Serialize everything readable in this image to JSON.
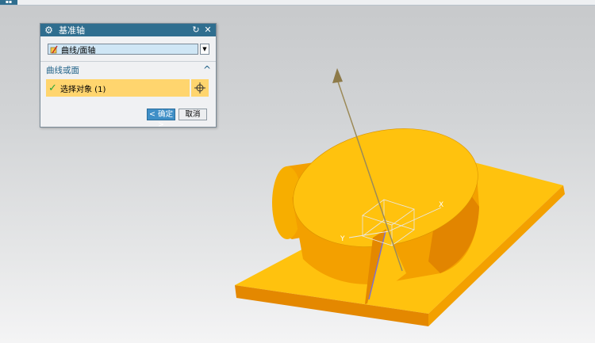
{
  "dialog": {
    "title": "基准轴",
    "type_select": {
      "selected": "曲线/面轴"
    },
    "ok_label": "< 确定 >",
    "cancel_label": "取消"
  },
  "group": {
    "title": "曲线或面",
    "select_object_label": "选择对象 (1)"
  },
  "viewport": {
    "csys_labels": {
      "y": "Y",
      "x": "X"
    }
  },
  "colors": {
    "titlebar": "#2f6e8f",
    "model_top": "#ffc20e",
    "model_side": "#f3a000",
    "model_shadow": "#e48800",
    "selection_highlight": "#ffd56e",
    "vector": "#9c8a58",
    "ok_button": "#3f8fc7"
  },
  "icons": [
    "settings-gear-icon",
    "reset-icon",
    "close-icon",
    "curve-face-axis-icon",
    "dropdown-arrow-icon",
    "collapse-chevron-icon",
    "check-icon",
    "point-dialog-icon"
  ]
}
